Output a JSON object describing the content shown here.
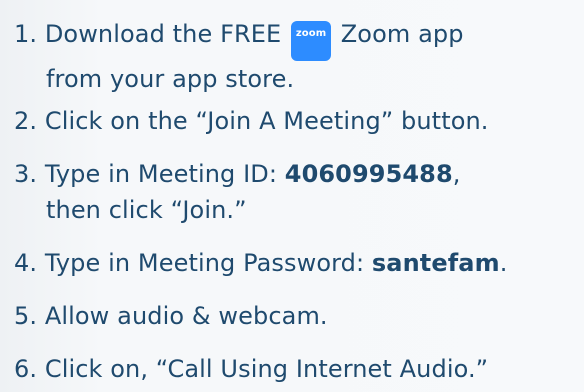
{
  "steps": [
    {
      "number": "1.",
      "line1_a": "Download the FREE",
      "icon_text": "zoom",
      "line1_b": "Zoom app",
      "line2": "from your app store."
    },
    {
      "number": "2.",
      "text": "Click on the “Join A Meeting” button."
    },
    {
      "number": "3.",
      "line1_a": "Type in Meeting ID:",
      "value": "4060995488",
      "line1_b": ",",
      "line2": "then click “Join.”"
    },
    {
      "number": "4.",
      "line1_a": "Type in Meeting Password:",
      "value": "santefam",
      "line1_b": "."
    },
    {
      "number": "5.",
      "text": "Allow audio & webcam."
    },
    {
      "number": "6.",
      "text": "Click on, “Call Using Internet Audio.”"
    }
  ]
}
